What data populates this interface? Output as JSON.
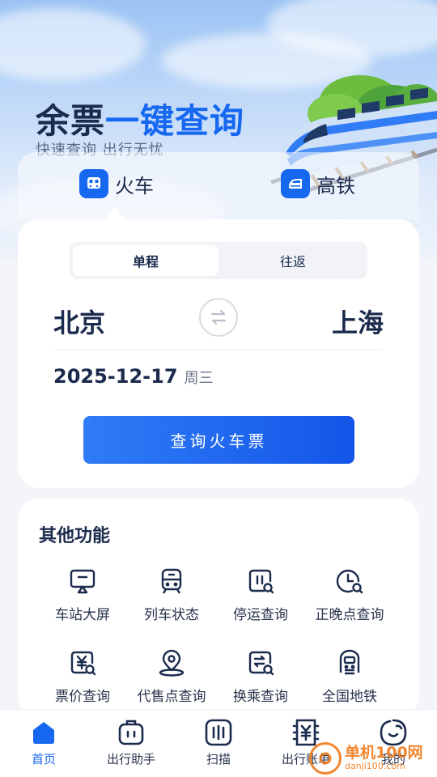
{
  "hero": {
    "title_part1": "余票",
    "title_part2": "一键查询",
    "subtitle": "快速查询 出行无忧"
  },
  "tabs": [
    {
      "label": "火车",
      "icon": "train-icon",
      "active": true
    },
    {
      "label": "高铁",
      "icon": "high-speed-train-icon",
      "active": false
    }
  ],
  "search": {
    "trip_types": [
      "单程",
      "往返"
    ],
    "selected_trip_type": "单程",
    "from_city": "北京",
    "to_city": "上海",
    "date": "2025-12-17",
    "weekday": "周三",
    "button_label": "查询火车票"
  },
  "other_functions": {
    "title": "其他功能",
    "items": [
      {
        "label": "车站大屏",
        "icon": "station-screen-icon"
      },
      {
        "label": "列车状态",
        "icon": "train-status-icon"
      },
      {
        "label": "停运查询",
        "icon": "suspension-query-icon"
      },
      {
        "label": "正晚点查询",
        "icon": "delay-query-icon"
      },
      {
        "label": "票价查询",
        "icon": "fare-query-icon"
      },
      {
        "label": "代售点查询",
        "icon": "agency-location-icon"
      },
      {
        "label": "换乘查询",
        "icon": "transfer-query-icon"
      },
      {
        "label": "全国地铁",
        "icon": "subway-icon"
      }
    ]
  },
  "bottom_nav": [
    {
      "label": "首页",
      "icon": "home-icon",
      "active": true
    },
    {
      "label": "出行助手",
      "icon": "luggage-icon",
      "active": false
    },
    {
      "label": "扫描",
      "icon": "scan-icon",
      "active": false
    },
    {
      "label": "出行账单",
      "icon": "bill-icon",
      "active": false
    },
    {
      "label": "我的",
      "icon": "profile-icon",
      "active": false
    }
  ],
  "watermark": {
    "name": "单机100网",
    "url": "danji100.com"
  },
  "colors": {
    "accent": "#1668f0",
    "title_dark": "#1b2b4d",
    "background": "#f3f5f9"
  }
}
